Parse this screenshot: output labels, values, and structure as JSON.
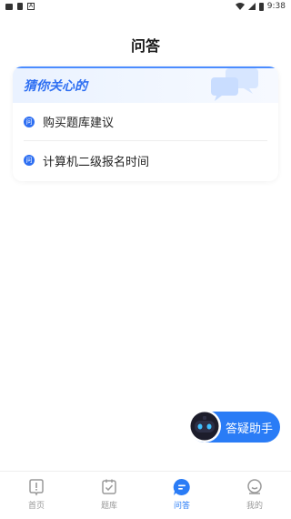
{
  "status_bar": {
    "time": "9:38",
    "left_icons": [
      "gallery-icon",
      "phone-icon",
      "text-a-icon"
    ],
    "right_icons": [
      "wifi-icon",
      "signal-icon",
      "battery-icon"
    ]
  },
  "header": {
    "title": "问答"
  },
  "card": {
    "title": "猜你关心的",
    "items": [
      {
        "icon_text": "问",
        "label": "购买题库建议"
      },
      {
        "icon_text": "问",
        "label": "计算机二级报名时间"
      }
    ]
  },
  "assistant": {
    "label": "答疑助手",
    "icon": "robot-icon"
  },
  "bottom_nav": {
    "items": [
      {
        "label": "首页",
        "icon": "home-alert-icon",
        "active": false
      },
      {
        "label": "题库",
        "icon": "calendar-check-icon",
        "active": false
      },
      {
        "label": "问答",
        "icon": "chat-icon",
        "active": true
      },
      {
        "label": "我的",
        "icon": "profile-icon",
        "active": false
      }
    ]
  },
  "colors": {
    "accent": "#2a7cf6",
    "card_title": "#2e6ff2",
    "inactive": "#9a9a9a"
  }
}
